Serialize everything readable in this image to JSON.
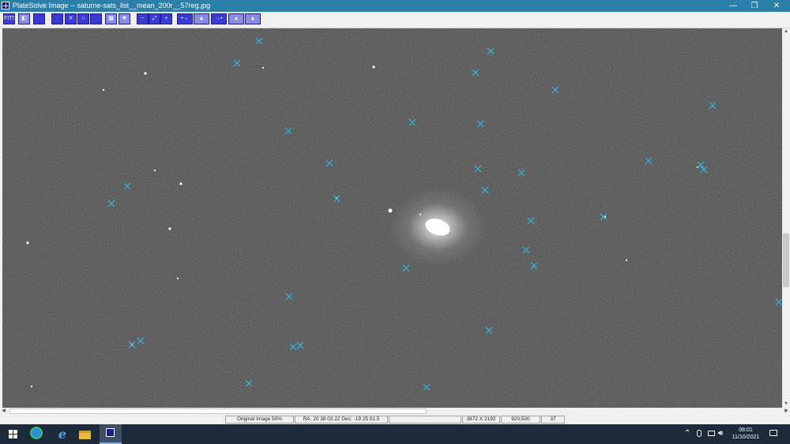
{
  "window": {
    "title": "PlateSolve Image -- saturne-sats_list__mean_200r__57reg.jpg",
    "minimize_glyph": "—",
    "restore_glyph": "❐",
    "close_glyph": "✕"
  },
  "toolbar": {
    "buttons": [
      {
        "name": "fits-button",
        "label": "FITS"
      },
      {
        "name": "panel-toggle-button",
        "label": "◧"
      },
      {
        "name": "view-button",
        "label": ""
      },
      {
        "name": "select-button",
        "label": ""
      },
      {
        "name": "cross-marker-button",
        "label": "✕"
      },
      {
        "name": "circle-marker-button",
        "label": "○"
      },
      {
        "name": "blank-button",
        "label": ""
      },
      {
        "name": "grid-button",
        "label": "▦"
      },
      {
        "name": "move-button",
        "label": "✥"
      },
      {
        "name": "zoom-out-button",
        "label": "−"
      },
      {
        "name": "fit-button",
        "label": "⤢"
      },
      {
        "name": "zoom-in-button",
        "label": "+"
      },
      {
        "name": "histogram-shift-left-button",
        "label": "•→"
      },
      {
        "name": "histogram-peak-button",
        "label": "▲"
      },
      {
        "name": "histogram-shift-right-button",
        "label": "→•"
      },
      {
        "name": "histogram-button",
        "label": "▲"
      },
      {
        "name": "histogram-alt-button",
        "label": "▲"
      }
    ]
  },
  "image": {
    "dimensions_label": "3872 X 2192",
    "object_glyph_color": "#ffffff",
    "marker_color": "#2fb8e6"
  },
  "status": {
    "zoom": "Original Image 50%",
    "coords": "RA: 20 38 03.22  Dec: -19 25 01.5",
    "empty": "",
    "dimensions": "3872 X 2192",
    "cursor": "920,500",
    "count": "37"
  },
  "taskbar": {
    "time": "08:01",
    "date": "11/10/2021",
    "tray_chevron": "⌃",
    "volume_glyph": "🔊︎"
  }
}
